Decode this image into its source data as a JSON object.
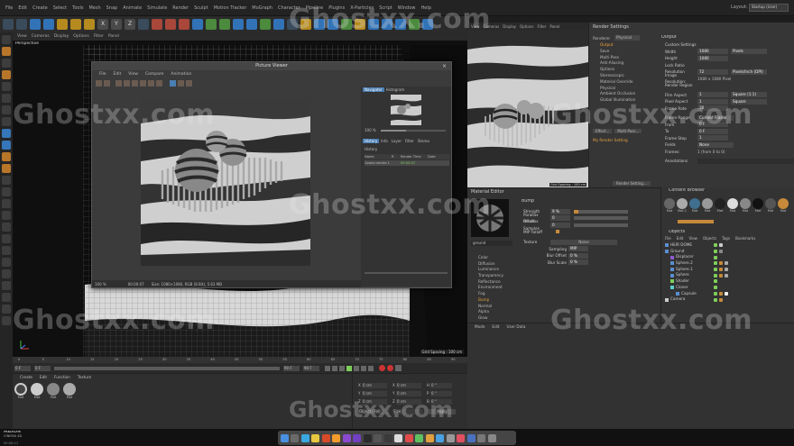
{
  "menubar": {
    "items": [
      "File",
      "Edit",
      "Create",
      "Select",
      "Tools",
      "Mesh",
      "Snap",
      "Animate",
      "Simulate",
      "Render",
      "Sculpt",
      "Motion Tracker",
      "MoGraph",
      "Character",
      "Pipeline",
      "Plugins",
      "X-Particles",
      "Script",
      "Window",
      "Help"
    ],
    "layout_label": "Layout:",
    "layout_value": "Startup (User)"
  },
  "toolbar": {
    "axis_labels": [
      "X",
      "Y",
      "Z"
    ]
  },
  "viewport": {
    "menu": [
      "View",
      "Cameras",
      "Display",
      "Options",
      "Filter",
      "Panel"
    ],
    "label": "Perspective",
    "grid_spacing": "Grid Spacing : 100 cm"
  },
  "picture_viewer": {
    "title": "Picture Viewer",
    "menu": [
      "File",
      "Edit",
      "View",
      "Compare",
      "Animation"
    ],
    "tabs_top": [
      "Navigator",
      "Histogram"
    ],
    "zoom": "100 %",
    "tabs_mid": [
      "History",
      "Info",
      "Layer",
      "Filter",
      "Stereo"
    ],
    "history_header": "History",
    "history_cols": [
      "Name",
      "R",
      "Render Time",
      "Date"
    ],
    "history_row": {
      "name": "Ozone render-1",
      "time": "00:00:07"
    },
    "status_zoom": "100 %",
    "status_time": "00:00:07",
    "status_size": "Size: 1080×1080, RGB (8 Bit), 5.63 MB"
  },
  "right_viewport": {
    "menu": [
      "View",
      "Cameras",
      "Display",
      "Options",
      "Filter",
      "Panel"
    ],
    "grid_spacing": "Grid Spacing : 100 cm"
  },
  "render_settings": {
    "title": "Render Settings",
    "renderer_label": "Renderer",
    "renderer_value": "Physical",
    "output_header": "Output",
    "list": [
      "Output",
      "Save",
      "Multi-Pass",
      "Anti-Aliasing",
      "Options",
      "Stereoscopic",
      "Material Override",
      "Physical",
      "Ambient Occlusion",
      "Global Illumination"
    ],
    "effect_button": "Effect...",
    "multipass_button": "Multi-Pass...",
    "my_render_setting": "My Render Setting",
    "render_setting_button": "Render Setting...",
    "custom_settings": "Custom Settings",
    "fields": [
      {
        "label": "Width",
        "value": "1080",
        "unit": "Pixels"
      },
      {
        "label": "Height",
        "value": "1080",
        "unit": ""
      },
      {
        "label": "Lock Ratio",
        "value": "",
        "unit": ""
      },
      {
        "label": "Resolution",
        "value": "72",
        "unit": "Pixels/Inch (DPI)"
      },
      {
        "label": "Image Resolution:",
        "value": "1080 x 1080 Pixel",
        "unit": ""
      },
      {
        "label": "Render Region",
        "value": "",
        "unit": ""
      },
      {
        "label": "Film Aspect",
        "value": "1",
        "unit": "Square (1:1)"
      },
      {
        "label": "Pixel Aspect",
        "value": "1",
        "unit": "Square"
      },
      {
        "label": "Frame Rate",
        "value": "30",
        "unit": ""
      },
      {
        "label": "Frame Range",
        "value": "Current Frame",
        "unit": ""
      },
      {
        "label": "From",
        "value": "0 F",
        "unit": ""
      },
      {
        "label": "To",
        "value": "0 F",
        "unit": ""
      },
      {
        "label": "Frame Step",
        "value": "1",
        "unit": ""
      },
      {
        "label": "Fields",
        "value": "None",
        "unit": ""
      },
      {
        "label": "Frames:",
        "value": "1 (from 0 to 0)",
        "unit": ""
      },
      {
        "label": "Annotations",
        "value": "",
        "unit": ""
      }
    ]
  },
  "material_editor": {
    "title": "Material Editor",
    "material_name": "ground",
    "bump_header": "Bump",
    "params": [
      {
        "label": "Strength",
        "value": "9 %",
        "fill": 0.09
      },
      {
        "label": "Parallax Offset",
        "value": "0",
        "fill": 0.0
      },
      {
        "label": "Parallax Samples",
        "value": "0",
        "fill": 0.0
      }
    ],
    "mip_falloff": "MIP Falloff",
    "texture_label": "Texture",
    "texture_value": "Noise",
    "sampling_label": "Sampling",
    "sampling_value": "MIP",
    "blur_offset_label": "Blur Offset",
    "blur_offset_value": "0 %",
    "blur_scale_label": "Blur Scale",
    "blur_scale_value": "0 %",
    "channels": [
      "Color",
      "Diffusion",
      "Luminance",
      "Transparency",
      "Reflectance",
      "Environment",
      "Fog",
      "Bump",
      "Normal",
      "Alpha",
      "Glow"
    ],
    "selected_channel": "Bump"
  },
  "content_browser": {
    "title": "Content Browser",
    "swatch_labels": [
      "Mat",
      "Mat.1",
      "Mat",
      "Mat",
      "Mat",
      "Mat",
      "Mat",
      "Mat",
      "Mat",
      "Mat"
    ]
  },
  "objects": {
    "title": "Objects",
    "menu": [
      "File",
      "Edit",
      "View",
      "Objects",
      "Tags",
      "Bookmarks"
    ],
    "items": [
      {
        "name": "HEIR DOME",
        "indent": 0
      },
      {
        "name": "Ground",
        "indent": 0
      },
      {
        "name": "Displacer",
        "indent": 1
      },
      {
        "name": "Sphere.2",
        "indent": 1
      },
      {
        "name": "Sphere.1",
        "indent": 1
      },
      {
        "name": "Sphere",
        "indent": 1
      },
      {
        "name": "Shader",
        "indent": 1
      },
      {
        "name": "Cloner",
        "indent": 1
      },
      {
        "name": "Capsule",
        "indent": 2
      },
      {
        "name": "Camera",
        "indent": 0
      }
    ]
  },
  "attributes": {
    "menu": [
      "Mode",
      "Edit",
      "User Data"
    ]
  },
  "timeline": {
    "ticks": [
      "0",
      "5",
      "10",
      "15",
      "20",
      "25",
      "30",
      "35",
      "40",
      "45",
      "50",
      "55",
      "60",
      "65",
      "70",
      "75",
      "80",
      "85",
      "90"
    ],
    "current_frame": "0 F",
    "start": "0 F",
    "end": "90 F",
    "end2": "90 F"
  },
  "materials": {
    "menu": [
      "Create",
      "Edit",
      "Function",
      "Texture"
    ],
    "swatches": [
      "Mat",
      "Mat",
      "Mat",
      "Mat"
    ]
  },
  "coords": {
    "rows": [
      {
        "a": "X",
        "av": "0 cm",
        "b": "X",
        "bv": "0 cm",
        "c": "H",
        "cv": "0 °"
      },
      {
        "a": "Y",
        "av": "0 cm",
        "b": "Y",
        "bv": "0 cm",
        "c": "P",
        "cv": "0 °"
      },
      {
        "a": "Z",
        "av": "0 cm",
        "b": "Z",
        "bv": "0 cm",
        "c": "B",
        "cv": "0 °"
      }
    ],
    "mode_a": "Object (Rel)",
    "mode_b": "Size",
    "apply": "Apply"
  },
  "statusbar": {
    "time": "00:00:11"
  },
  "brand": {
    "maxon_line1": "MAXON",
    "maxon_line2": "CINEMA 4D"
  },
  "watermarks": [
    "Ghostxx.com",
    "Ghostxx.com",
    "Ghostxx.com",
    "Ghostxx.com",
    "Ghostxx.com",
    "Ghostxx.com",
    "Ghostxx.com"
  ]
}
